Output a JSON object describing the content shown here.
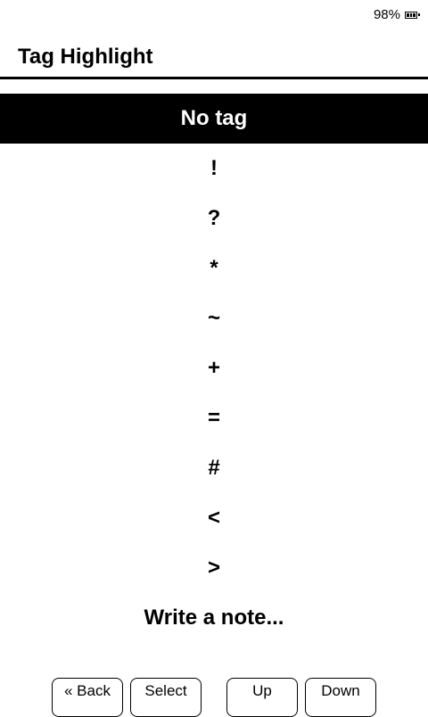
{
  "status": {
    "battery_text": "98%",
    "battery_icon": "battery-icon"
  },
  "header": {
    "title": "Tag Highlight"
  },
  "tags": [
    {
      "label": "No tag",
      "selected": true
    },
    {
      "label": "!",
      "selected": false
    },
    {
      "label": "?",
      "selected": false
    },
    {
      "label": "*",
      "selected": false
    },
    {
      "label": "~",
      "selected": false
    },
    {
      "label": "+",
      "selected": false
    },
    {
      "label": "=",
      "selected": false
    },
    {
      "label": "#",
      "selected": false
    },
    {
      "label": "<",
      "selected": false
    },
    {
      "label": ">",
      "selected": false
    },
    {
      "label": "Write a note...",
      "selected": false
    }
  ],
  "buttons": {
    "back": "« Back",
    "select": "Select",
    "up": "Up",
    "down": "Down"
  }
}
